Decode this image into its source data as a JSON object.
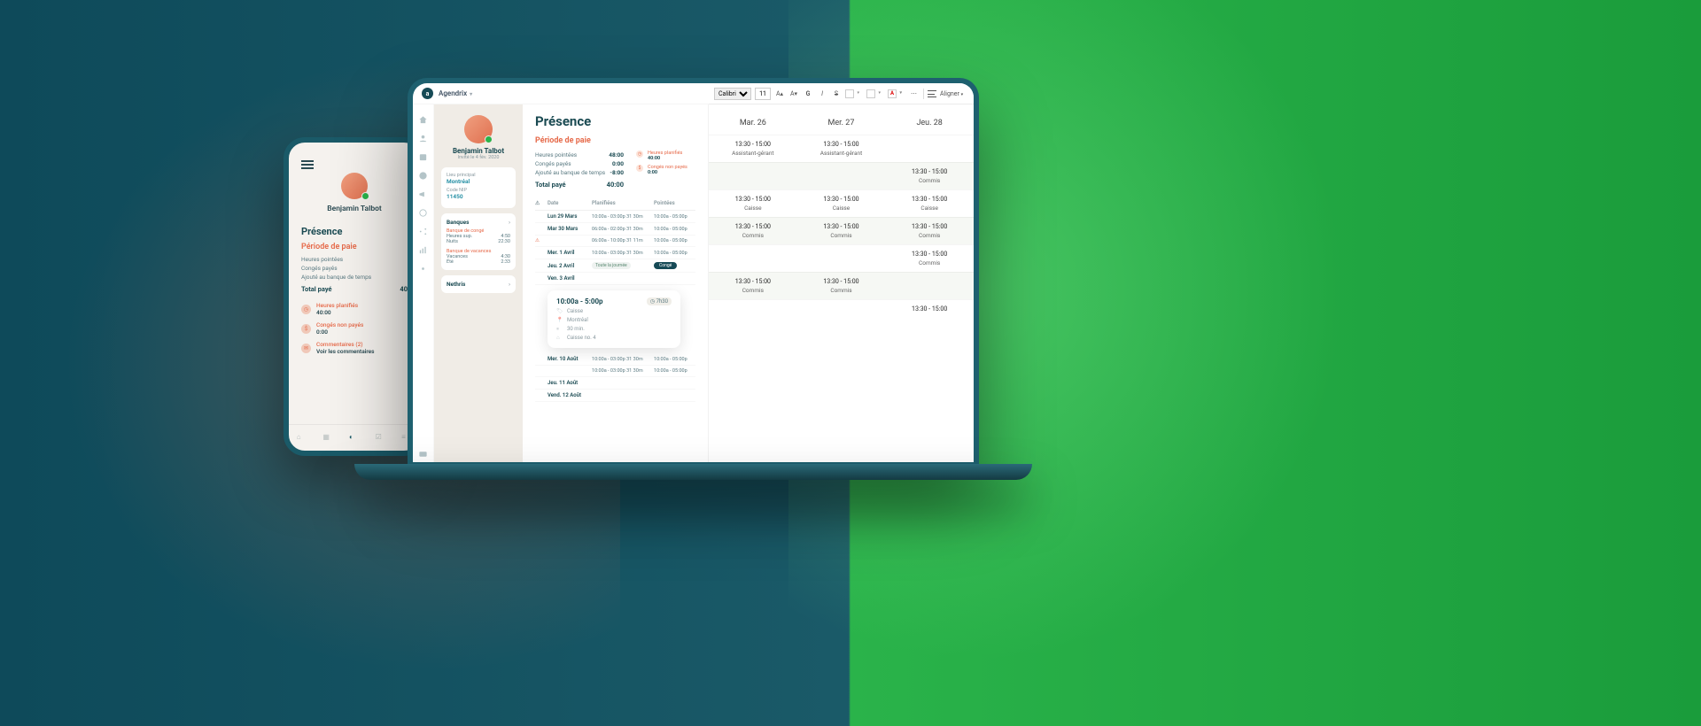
{
  "app": {
    "brand": "Agendrix"
  },
  "person": {
    "name": "Benjamin Talbot",
    "invited": "Invité le  4 fév. 2020"
  },
  "phone": {
    "title": "Présence",
    "section": "Période de paie",
    "rows": [
      {
        "l": "Heures pointées",
        "v": ""
      },
      {
        "l": "Congés payés",
        "v": ""
      },
      {
        "l": "Ajouté au banque de temps",
        "v": ""
      }
    ],
    "total": {
      "l": "Total payé",
      "v": "40"
    },
    "cards": [
      {
        "t1": "Heures planifiés",
        "t2": "40:00"
      },
      {
        "t1": "Congés non payés",
        "t2": "0:00"
      },
      {
        "t1": "Commentaires (2)",
        "t2": "Voir les commentaires"
      }
    ]
  },
  "main": {
    "title": "Présence",
    "section": "Période de paie",
    "summary": [
      {
        "l": "Heures pointées",
        "v": "48:00"
      },
      {
        "l": "Congés payés",
        "v": "0:00"
      },
      {
        "l": "Ajouté au banque de temps",
        "v": "-8:00"
      }
    ],
    "total": {
      "l": "Total payé",
      "v": "40:00"
    },
    "side": [
      {
        "t1": "Heures planifiés",
        "t2": "40:00"
      },
      {
        "t1": "Congés non payés",
        "t2": "0:00"
      }
    ],
    "thead": {
      "warn": "⚠",
      "date": "Date",
      "plan": "Planifiées",
      "point": "Pointées"
    },
    "trows": [
      {
        "w": "",
        "d": "Lun 29 Mars",
        "p": "10:00a - 03:00p   31  30m",
        "q": "10:00a   -   05:00p"
      },
      {
        "w": "",
        "d": "Mar 30 Mars",
        "p": "06:00a - 02:00p   31  30m",
        "q": "10:00a   -   05:00p"
      },
      {
        "w": "⚠",
        "d": "",
        "p": "06:00a - 10:00p   31  11m",
        "q": "10:00a   -   05:00p"
      },
      {
        "w": "",
        "d": "Mer. 1 Avril",
        "p": "10:00a - 03:00p   31  30m",
        "q": "10:00a   -   05:00p"
      },
      {
        "w": "",
        "d": "Jeu. 2 Avril",
        "p": "__day__",
        "q": "__conge__"
      },
      {
        "w": "",
        "d": "Ven. 3 Avril",
        "p": "",
        "q": ""
      }
    ],
    "day_label": "Toute la journée",
    "conge_label": "Congé",
    "trows2": [
      {
        "w": "",
        "d": "Mer. 10 Août",
        "p": "10:00a - 03:00p   31  30m",
        "q": "10:00a   -   05:00p"
      },
      {
        "w": "",
        "d": "",
        "p": "10:00a - 03:00p   31  30m",
        "q": "10:00a   -   05:00p"
      },
      {
        "w": "",
        "d": "Jeu. 11 Août",
        "p": "",
        "q": ""
      },
      {
        "w": "",
        "d": "Vend. 12 Août",
        "p": "",
        "q": ""
      }
    ],
    "shift": {
      "time": "10:00a - 5:00p",
      "dur": "7h30",
      "role": "Caisse",
      "loc": "Montréal",
      "break": "30 min.",
      "till": "Caisse no. 4"
    }
  },
  "profile": {
    "lieu_l": "Lieu principal",
    "lieu_v": "Montréal",
    "code_l": "Code NIP",
    "code_v": "11450",
    "banques": "Banques",
    "bq1": "Banque de congé",
    "bq1_rows": [
      {
        "l": "Heures sup.",
        "v": "4:50"
      },
      {
        "l": "Nuits",
        "v": "22:30"
      }
    ],
    "bq2": "Banque de vacances",
    "bq2_rows": [
      {
        "l": "Vacances",
        "v": "4:30"
      },
      {
        "l": "Été",
        "v": "2:33"
      }
    ],
    "nethris": "Nethris"
  },
  "spreadsheet": {
    "font": "Calibri",
    "size": "11",
    "align": "Aligner",
    "days": [
      "Mar. 26",
      "Mer. 27",
      "Jeu. 28"
    ],
    "groups": [
      {
        "alt": false,
        "cells": [
          [
            "13:30 - 15:00",
            "Assistant-gérant"
          ],
          [
            "13:30 - 15:00",
            "Assistant-gérant"
          ],
          [
            "",
            ""
          ]
        ]
      },
      {
        "alt": true,
        "cells": [
          [
            "",
            ""
          ],
          [
            "",
            ""
          ],
          [
            "13:30 - 15:00",
            "Commis"
          ]
        ]
      },
      {
        "alt": false,
        "cells": [
          [
            "13:30 - 15:00",
            "Caisse"
          ],
          [
            "13:30 - 15:00",
            "Caisse"
          ],
          [
            "13:30 - 15:00",
            "Caisse"
          ]
        ]
      },
      {
        "alt": true,
        "cells": [
          [
            "13:30 - 15:00",
            "Commis"
          ],
          [
            "13:30 - 15:00",
            "Commis"
          ],
          [
            "13:30 - 15:00",
            "Commis"
          ]
        ]
      },
      {
        "alt": false,
        "cells": [
          [
            "",
            ""
          ],
          [
            "",
            ""
          ],
          [
            "13:30 - 15:00",
            "Commis"
          ]
        ]
      },
      {
        "alt": true,
        "cells": [
          [
            "13:30 - 15:00",
            "Commis"
          ],
          [
            "13:30 - 15:00",
            "Commis"
          ],
          [
            "",
            ""
          ]
        ]
      },
      {
        "alt": false,
        "cells": [
          [
            "",
            ""
          ],
          [
            "",
            ""
          ],
          [
            "13:30 - 15:00",
            ""
          ]
        ]
      }
    ]
  }
}
